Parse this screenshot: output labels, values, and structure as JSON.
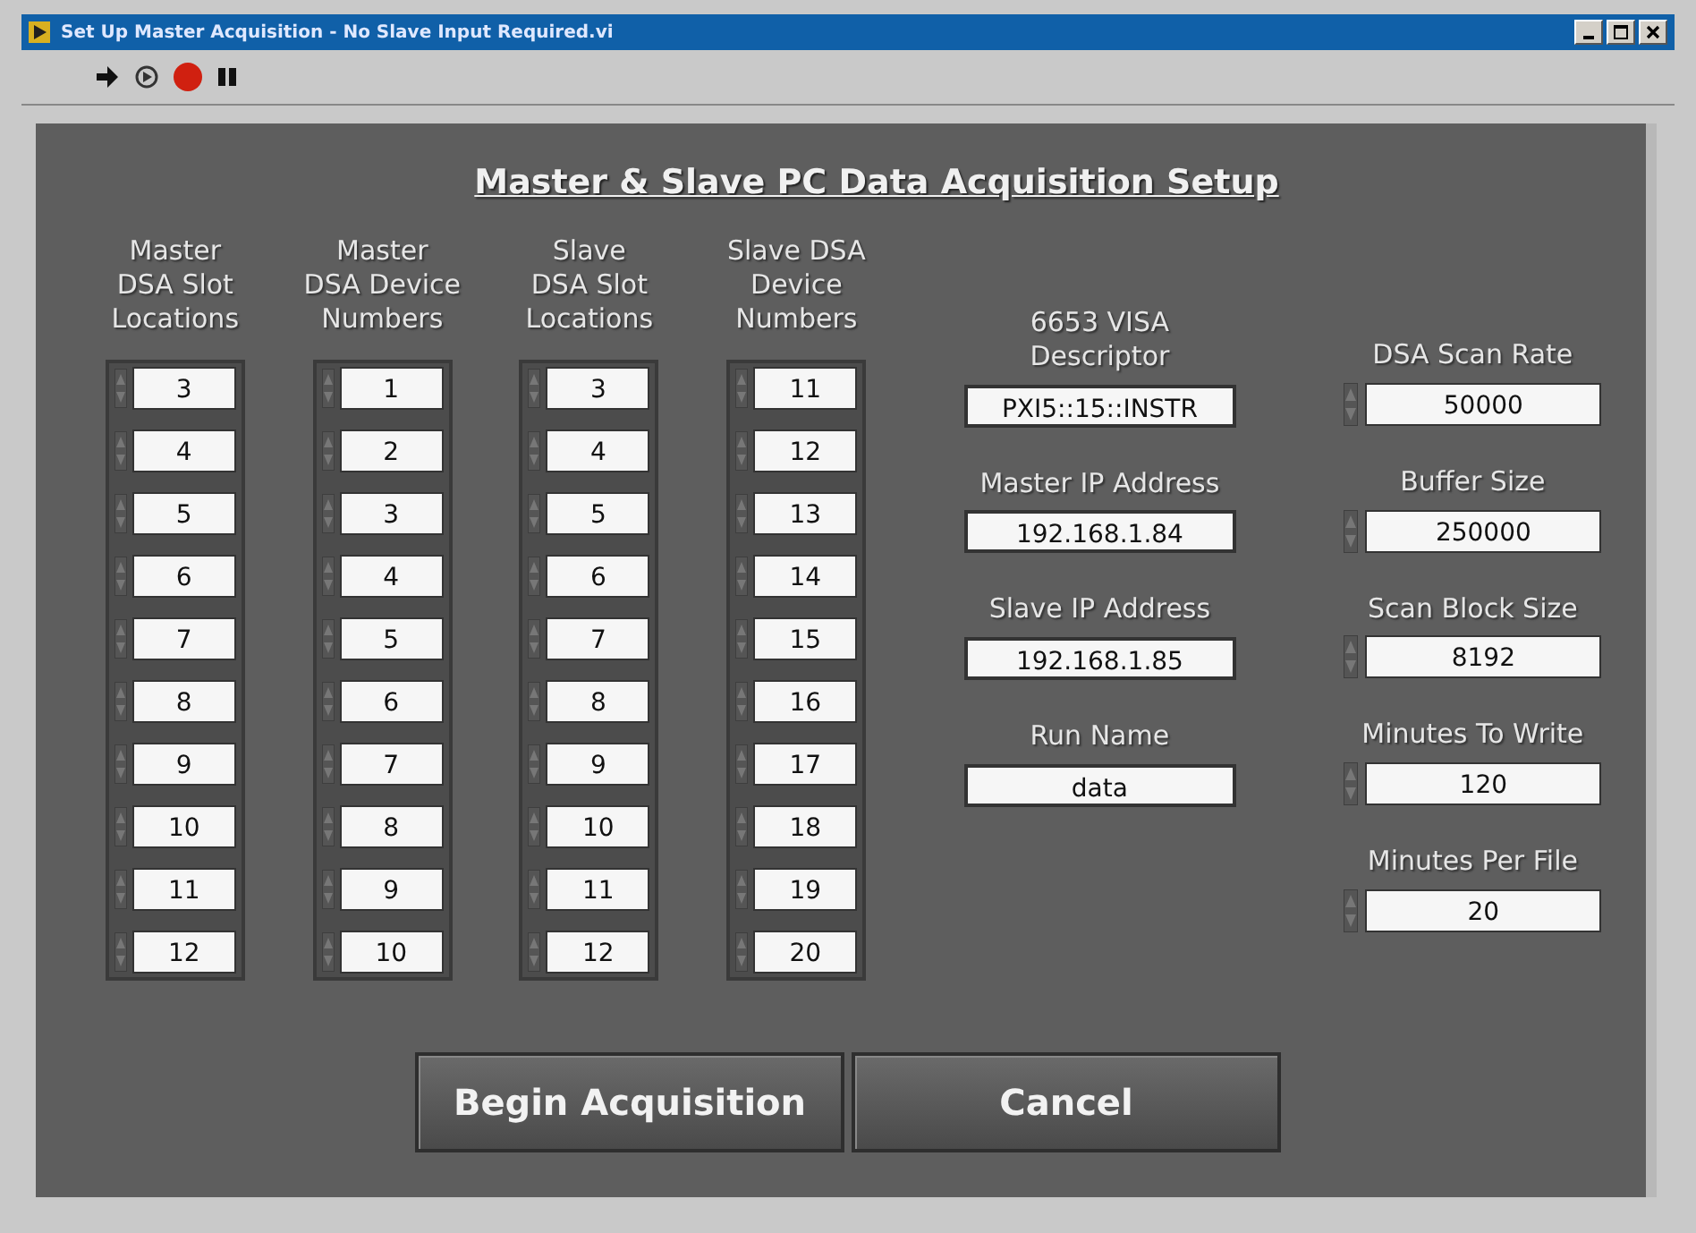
{
  "window": {
    "title": "Set Up Master Acquisition - No Slave Input Required.vi"
  },
  "panel": {
    "title": "Master & Slave PC Data Acquisition Setup"
  },
  "arrays": [
    {
      "label": "Master\nDSA Slot\nLocations",
      "values": [
        "3",
        "4",
        "5",
        "6",
        "7",
        "8",
        "9",
        "10",
        "11",
        "12"
      ]
    },
    {
      "label": "Master\nDSA Device\nNumbers",
      "values": [
        "1",
        "2",
        "3",
        "4",
        "5",
        "6",
        "7",
        "8",
        "9",
        "10"
      ]
    },
    {
      "label": "Slave\nDSA Slot\nLocations",
      "values": [
        "3",
        "4",
        "5",
        "6",
        "7",
        "8",
        "9",
        "10",
        "11",
        "12"
      ]
    },
    {
      "label": "Slave DSA\nDevice\nNumbers",
      "values": [
        "11",
        "12",
        "13",
        "14",
        "15",
        "16",
        "17",
        "18",
        "19",
        "20"
      ]
    }
  ],
  "string_controls": [
    {
      "label": "6653 VISA\nDescriptor",
      "value": "PXI5::15::INSTR"
    },
    {
      "label": "Master IP Address",
      "value": "192.168.1.84"
    },
    {
      "label": "Slave IP Address",
      "value": "192.168.1.85"
    },
    {
      "label": "Run Name",
      "value": "data"
    }
  ],
  "numeric_controls": [
    {
      "label": "DSA Scan Rate",
      "value": "50000"
    },
    {
      "label": "Buffer Size",
      "value": "250000"
    },
    {
      "label": "Scan Block Size",
      "value": "8192"
    },
    {
      "label": "Minutes To Write",
      "value": "120"
    },
    {
      "label": "Minutes Per File",
      "value": "20"
    }
  ],
  "buttons": [
    "Begin Acquisition",
    "Cancel"
  ]
}
